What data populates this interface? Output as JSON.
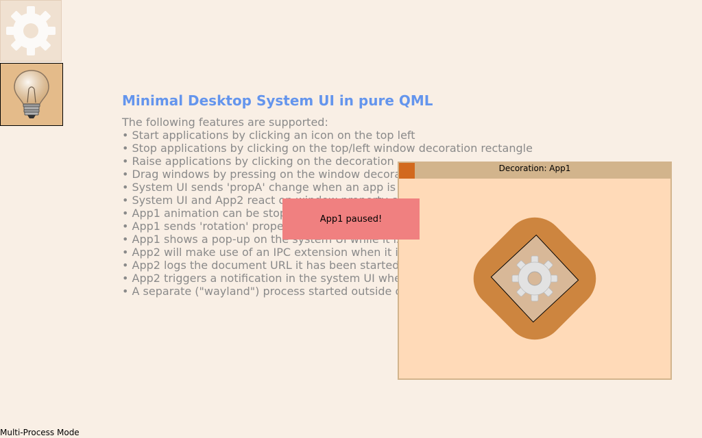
{
  "launcher": {
    "app1_icon": "gear-icon",
    "app2_icon": "lightbulb-icon"
  },
  "main": {
    "title": "Minimal Desktop System UI in pure QML",
    "intro": "The following features are supported:",
    "features": [
      "• Start applications by clicking an icon on the top left",
      "• Stop applications by clicking on the top/left window decoration rectangle",
      "• Raise applications by clicking on the decoration",
      "• Drag windows by pressing on the window decora",
      "• System UI sends 'propA' change when an app is",
      "• System UI and App2 react on window property c",
      "• App1 animation can be stop",
      "• App1 sends 'rotation' prope",
      "• App1 shows a pop-up on the system UI while it is",
      "• App2 will make use of an IPC extension when it i",
      "• App2 logs the document URL it has been started",
      "• App2 triggers a notification in the system UI whe",
      "• A separate (\"wayland\") process started outside o"
    ]
  },
  "window": {
    "decoration_label": "Decoration: App1"
  },
  "popup": {
    "text": "App1 paused!"
  },
  "status": {
    "mode": "Multi-Process Mode"
  },
  "colors": {
    "background": "#f9efe5",
    "title": "#6495ed",
    "decoration": "#d2b48c",
    "close_rect": "#d2691e",
    "popup": "#f08080",
    "app_rounded_square": "#cd853f"
  }
}
